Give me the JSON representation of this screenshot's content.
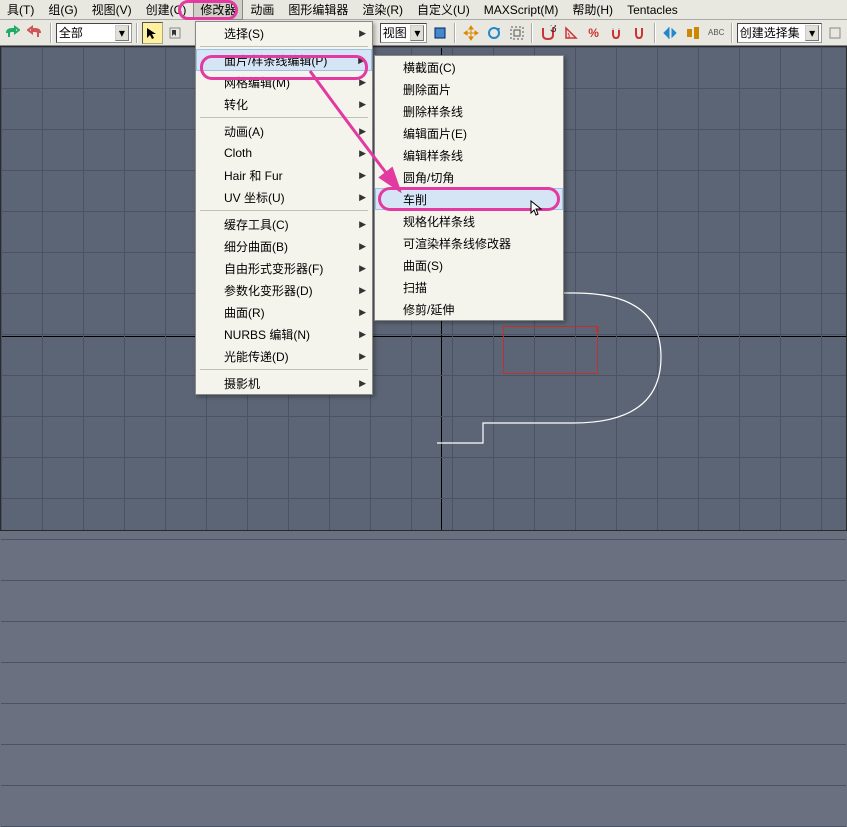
{
  "menubar": {
    "items": [
      {
        "label": "具(T)"
      },
      {
        "label": "组(G)"
      },
      {
        "label": "视图(V)"
      },
      {
        "label": "创建(C)"
      },
      {
        "label": "修改器"
      },
      {
        "label": "动画"
      },
      {
        "label": "图形编辑器"
      },
      {
        "label": "渲染(R)"
      },
      {
        "label": "自定义(U)"
      },
      {
        "label": "MAXScript(M)"
      },
      {
        "label": "帮助(H)"
      },
      {
        "label": "Tentacles"
      }
    ],
    "active_index": 4
  },
  "toolbar": {
    "scope_label": "全部",
    "view_label": "视图",
    "create_set_label": "创建选择集",
    "icons": {
      "undo": "undo",
      "redo": "redo",
      "select": "select",
      "link": "link",
      "selectbox": "selectbox",
      "move": "move",
      "rotate": "rotate",
      "scale": "scale",
      "snap": "snap",
      "angle": "angle",
      "percent": "percent",
      "magnet1": "magnet1",
      "magnet2": "magnet2",
      "mirror": "mirror",
      "align": "align",
      "text": "ABC"
    }
  },
  "modifier_menu": {
    "items": [
      {
        "label": "选择(S)",
        "sub": true
      },
      {
        "label": "面片/样条线编辑(P)",
        "sub": true,
        "hl": true
      },
      {
        "label": "网格编辑(M)",
        "sub": true
      },
      {
        "label": "转化",
        "sub": true
      },
      {
        "label": "动画(A)",
        "sub": true
      },
      {
        "label": "Cloth",
        "sub": true
      },
      {
        "label": "Hair 和 Fur",
        "sub": true
      },
      {
        "label": "UV 坐标(U)",
        "sub": true
      },
      {
        "label": "缓存工具(C)",
        "sub": true
      },
      {
        "label": "细分曲面(B)",
        "sub": true
      },
      {
        "label": "自由形式变形器(F)",
        "sub": true
      },
      {
        "label": "参数化变形器(D)",
        "sub": true
      },
      {
        "label": "曲面(R)",
        "sub": true
      },
      {
        "label": "NURBS 编辑(N)",
        "sub": true
      },
      {
        "label": "光能传递(D)",
        "sub": true
      },
      {
        "label": "摄影机",
        "sub": true
      }
    ]
  },
  "sub_menu": {
    "items": [
      {
        "label": "横截面(C)"
      },
      {
        "label": "删除面片"
      },
      {
        "label": "删除样条线"
      },
      {
        "label": "编辑面片(E)"
      },
      {
        "label": "编辑样条线"
      },
      {
        "label": "圆角/切角"
      },
      {
        "label": "车削",
        "hl": true
      },
      {
        "label": "规格化样条线"
      },
      {
        "label": "可渲染样条线修改器"
      },
      {
        "label": "曲面(S)"
      },
      {
        "label": "扫描"
      },
      {
        "label": "修剪/延伸"
      }
    ]
  }
}
